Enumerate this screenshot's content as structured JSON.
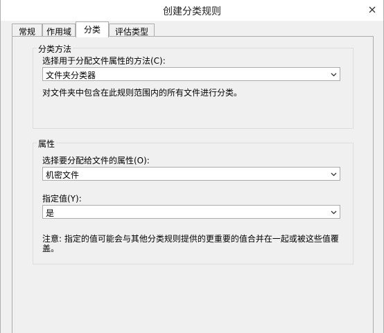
{
  "window": {
    "title": "创建分类规则"
  },
  "tabs": [
    {
      "label": "常规"
    },
    {
      "label": "作用域"
    },
    {
      "label": "分类"
    },
    {
      "label": "评估类型"
    }
  ],
  "classification": {
    "group_title": "分类方法",
    "method_label": "选择用于分配文件属性的方法(C):",
    "method_value": "文件夹分类器",
    "method_desc": "对文件夹中包含在此规则范围内的所有文件进行分类。"
  },
  "property": {
    "group_title": "属性",
    "prop_label": "选择要分配给文件的属性(O):",
    "prop_value": "机密文件",
    "value_label": "指定值(Y):",
    "value_value": "是",
    "note": "注意: 指定的值可能会与其他分类规则提供的更重要的值合并在一起或被这些值覆盖。"
  },
  "icons": {
    "close": "close-icon",
    "dropdown": "chevron-down-icon"
  }
}
